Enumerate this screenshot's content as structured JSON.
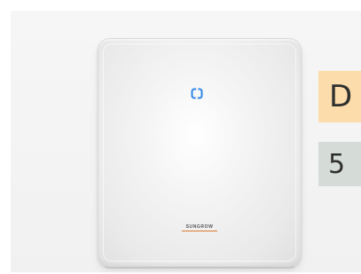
{
  "product": {
    "brand_text": "SUNGROW",
    "status_icon": "status-led-icon",
    "status_led_color": "#2f86e8",
    "brand_accent_color": "#e07a2a"
  },
  "side_labels": [
    {
      "text": "D",
      "background": "#fbdcaa"
    },
    {
      "text": "5",
      "background": "#d5dcd8"
    }
  ]
}
